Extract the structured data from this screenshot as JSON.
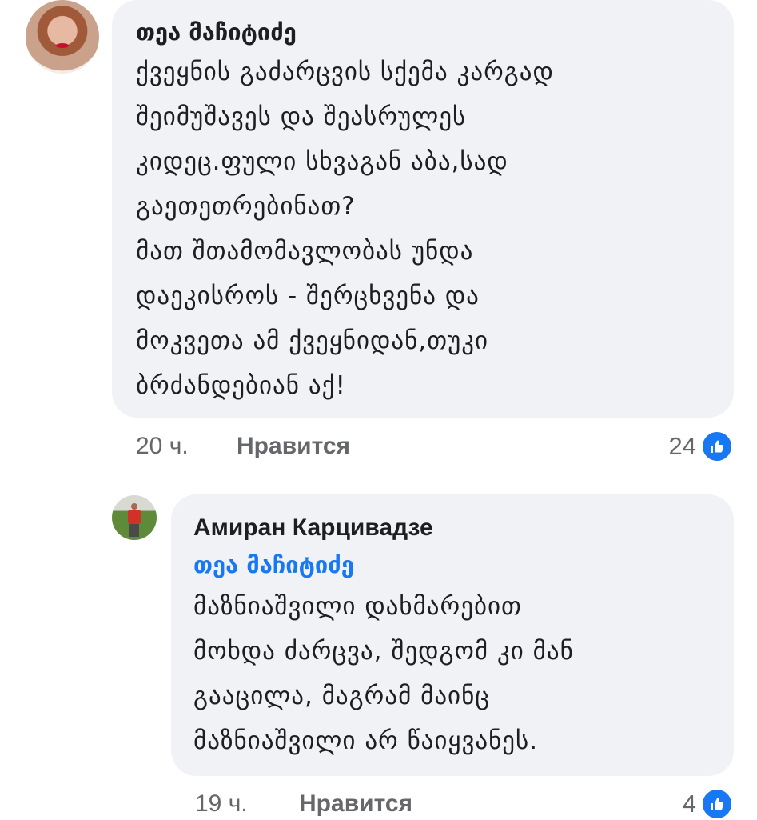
{
  "comments": [
    {
      "author": "თეა მაჩიტიძე",
      "text": "ქვეყნის გაძარცვის სქემა კარგად\nშეიმუშავეს და შეასრულეს\nკიდეც.ფული სხვაგან აბა,სად\nგაეთეთრებინათ?\nმათ შთამომავლობას უნდა\nდაეკისროს - შერცხვენა და\nმოკვეთა ამ ქვეყნიდან,თუკი\nბრძანდებიან აქ!",
      "time": "20 ч.",
      "like_label": "Нравится",
      "reaction_count": "24",
      "reaction_icon": "thumbs-up-icon",
      "reaction_color": "#1877f2"
    },
    {
      "author": "Амиран Карцивадзе",
      "mention": "თეა მაჩიტიძე",
      "text": "მაზნიაშვილი დახმარებით\nმოხდა ძარცვა, შედგომ კი მან\nგააცილა, მაგრამ მაინც\nმაზნიაშვილი არ წაიყვანეს.",
      "time": "19 ч.",
      "like_label": "Нравится",
      "reaction_count": "4",
      "reaction_icon": "thumbs-up-icon",
      "reaction_color": "#1877f2"
    }
  ]
}
